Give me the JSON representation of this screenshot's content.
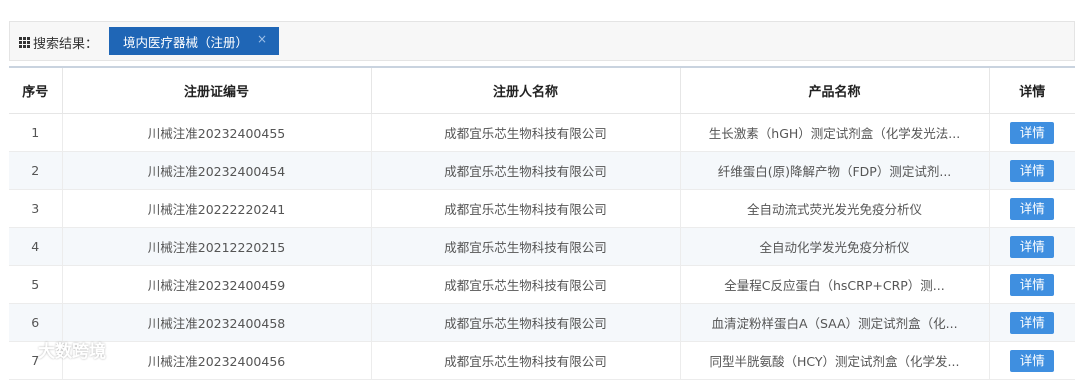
{
  "search": {
    "label": "搜索结果：",
    "tag_label": "境内医疗器械（注册）",
    "tag_close": "×"
  },
  "table": {
    "columns": [
      "序号",
      "注册证编号",
      "注册人名称",
      "产品名称",
      "详情"
    ],
    "rows": [
      {
        "index": "1",
        "reg_no": "川械注准20232400455",
        "registrant": "成都宜乐芯生物科技有限公司",
        "product": "生长激素（hGH）测定试剂盒（化学发光法...",
        "detail": "详情"
      },
      {
        "index": "2",
        "reg_no": "川械注准20232400454",
        "registrant": "成都宜乐芯生物科技有限公司",
        "product": "纤维蛋白(原)降解产物（FDP）测定试剂...",
        "detail": "详情"
      },
      {
        "index": "3",
        "reg_no": "川械注准20222220241",
        "registrant": "成都宜乐芯生物科技有限公司",
        "product": "全自动流式荧光发光免疫分析仪",
        "detail": "详情"
      },
      {
        "index": "4",
        "reg_no": "川械注准20212220215",
        "registrant": "成都宜乐芯生物科技有限公司",
        "product": "全自动化学发光免疫分析仪",
        "detail": "详情"
      },
      {
        "index": "5",
        "reg_no": "川械注准20232400459",
        "registrant": "成都宜乐芯生物科技有限公司",
        "product": "全量程C反应蛋白（hsCRP+CRP）测...",
        "detail": "详情"
      },
      {
        "index": "6",
        "reg_no": "川械注准20232400458",
        "registrant": "成都宜乐芯生物科技有限公司",
        "product": "血清淀粉样蛋白A（SAA）测定试剂盒（化...",
        "detail": "详情"
      },
      {
        "index": "7",
        "reg_no": "川械注准20232400456",
        "registrant": "成都宜乐芯生物科技有限公司",
        "product": "同型半胱氨酸（HCY）测定试剂盒（化学发...",
        "detail": "详情"
      }
    ]
  },
  "watermark": {
    "text": "大数跨境"
  },
  "colors": {
    "tag_bg": "#1f66b6",
    "button_bg": "#3f8fe0",
    "row_alt": "#f5f8fb"
  }
}
